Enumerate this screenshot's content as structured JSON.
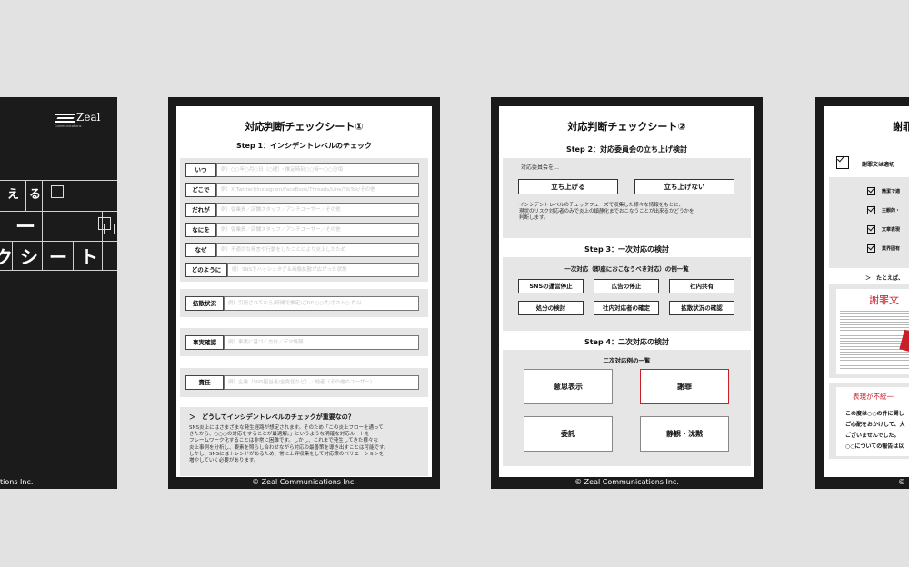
{
  "cover": {
    "logo_text": "Zeal",
    "logo_sub": "Communications",
    "row1_chars": [
      "え",
      "る"
    ],
    "row2_chars": [
      "ー"
    ],
    "row3_chars": [
      "ク",
      "シ",
      "ー",
      "ト"
    ],
    "footer": "tions Inc."
  },
  "sheet1": {
    "title": "対応判断チェックシート①",
    "step1": "Step 1：インシデントレベルのチェック",
    "rows": [
      {
        "label": "いつ",
        "placeholder": "例）○○年○月○日（○曜）・推定時刻○○時～○○分頃"
      },
      {
        "label": "どこで",
        "placeholder": "例）X(Twitter)/Instagram/FaceBook/Threads/Line/TikTok/その他"
      },
      {
        "label": "だれが",
        "placeholder": "例）従業員／店舗スタッフ／アンチユーザー／その他"
      },
      {
        "label": "なにを",
        "placeholder": "例）従業員／店舗スタッフ／アンチユーザー／その他"
      },
      {
        "label": "なぜ",
        "placeholder": "例）不適切な発言や行動をしたことにより炎上したため"
      },
      {
        "label": "どのように",
        "placeholder": "例）SNSでハッシュタグ＆画像拡散が広がった状態"
      }
    ],
    "spread_label": "拡散状況",
    "spread_placeholder": "例）引用されてから(時間で推定)ごRP ○○件/ポスト○ 件以",
    "fact_label": "事実確認",
    "fact_placeholder": "例）事実に基づく方針／デマ情報",
    "resp_label": "責任",
    "resp_placeholder": "例）企業（SNS担当者/全責任など）／他者（その他のユーザー）",
    "note_title": "＞　どうしてインシデントレベルのチェックが重要なの？",
    "note_lines": [
      "SNS炎上にはさまざまな発生経路が想定されます。そのため「この炎上フローを通って",
      "きたから、○○○の対応をすることが最適解。」というような明確な対応ルートを",
      "フレームワーク化することは非常に困難です。しかし、これまで発生してきた様々な",
      "炎上事例を分析し、要素を照らし合わせながら対応の最善策を導き出すことは可能です。",
      "しかし、SNSにはトレンドがあるため、常に上昇収集をして対応策のバリエーションを",
      "増やしていく必要があります。"
    ],
    "footer": "© Zeal Communications Inc."
  },
  "sheet2": {
    "title": "対応判断チェックシート②",
    "step2": "Step 2：対応委員会の立ち上げ検討",
    "committee_label": "対応委員会を…",
    "btn_launch": "立ち上げる",
    "btn_no_launch": "立ち上げない",
    "desc_lines": [
      "インシデントレベルのチェックフェーズで収集した様々な情報をもとに、",
      "現状のリスク対応者のみで炎上の鎮静化までおこなうことが出来るかどうかを",
      "判断します。"
    ],
    "step3": "Step 3：一次対応の検討",
    "first_list_title": "一次対応（即座におこなうべき対応）の例一覧",
    "first_items": [
      "SNSの運営停止",
      "広告の停止",
      "社内共有",
      "処分の検討",
      "社内対応者の確定",
      "拡散状況の確認"
    ],
    "step4": "Step 4：二次対応の検討",
    "second_list_title": "二次対応例の一覧",
    "second_items": [
      "意思表示",
      "謝罪",
      "委託",
      "静観・沈黙"
    ],
    "highlight_color": "#c8202a",
    "footer": "© Zeal Communications Inc."
  },
  "sheet3": {
    "title_partial": "謝罪文",
    "main_check": "謝罪文は適切",
    "checks": [
      "簡潔で適",
      "主観的・",
      "文章表現",
      "業界固有"
    ],
    "example_intro": "＞　たとえば、",
    "doc_heading": "謝罪文",
    "bad_label": "表現が不統一",
    "bad_lines": [
      "この度は○○の件に関し",
      "ご心配をおかけして、大",
      "ございませんでした。",
      "○○についての報告は以"
    ],
    "footer": "©"
  }
}
